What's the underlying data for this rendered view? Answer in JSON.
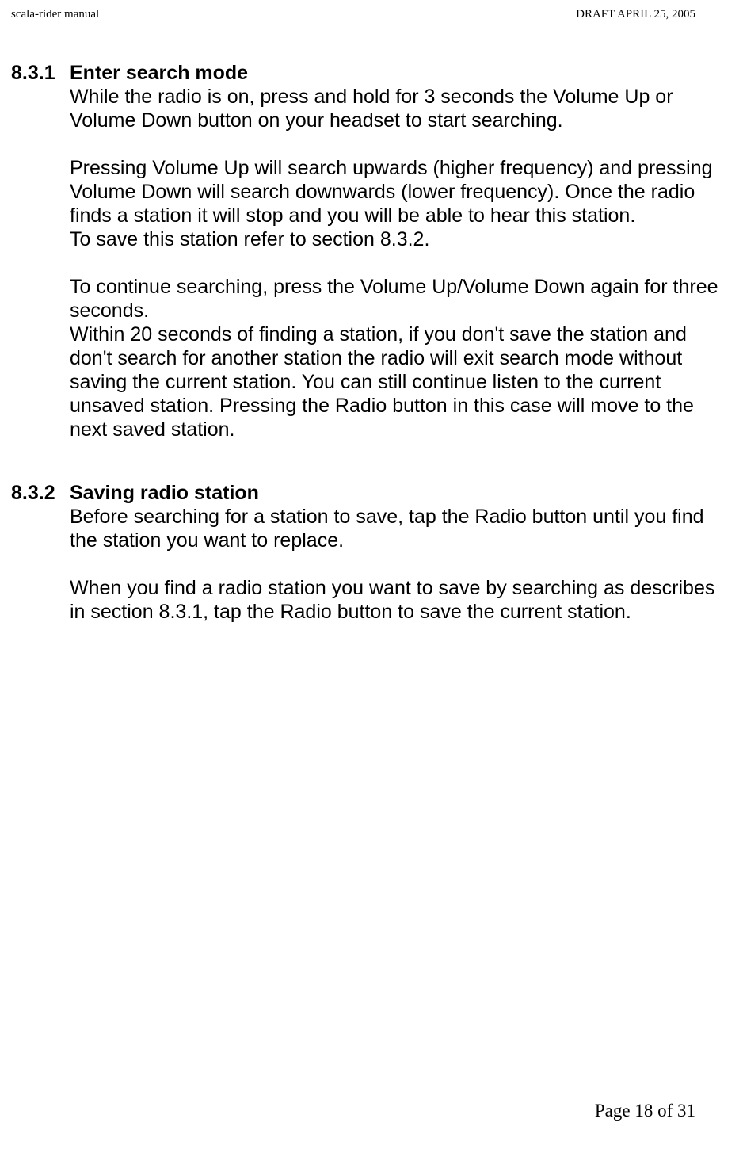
{
  "header": {
    "left": "scala-rider manual",
    "right": "DRAFT  APRIL 25, 2005"
  },
  "sections": [
    {
      "num": "8.3.1",
      "title": "Enter search mode",
      "paras": [
        "While the radio is on, press and hold for 3 seconds the Volume Up or Volume Down button on your headset to start searching.",
        "",
        "Pressing Volume Up will search upwards (higher frequency) and pressing Volume Down will search downwards (lower frequency). Once the radio finds a station it will stop and you will be able to hear this station.",
        "To save this station refer to section 8.3.2.",
        "",
        "To continue searching, press the Volume Up/Volume Down again for three seconds.",
        "Within 20 seconds of finding a station, if you don't save the station and don't search for another station the radio will exit search mode without saving the current station. You can still continue listen to the current unsaved station. Pressing the Radio button in this case will move to the next saved station."
      ]
    },
    {
      "num": "8.3.2",
      "title": "Saving radio station",
      "paras": [
        "Before searching for a station to save, tap the Radio button until you find the station you want to replace.",
        "",
        "When you find a radio station you want to save by searching as describes in section  8.3.1, tap the Radio button to save the current station."
      ]
    }
  ],
  "footer": "Page 18 of 31"
}
